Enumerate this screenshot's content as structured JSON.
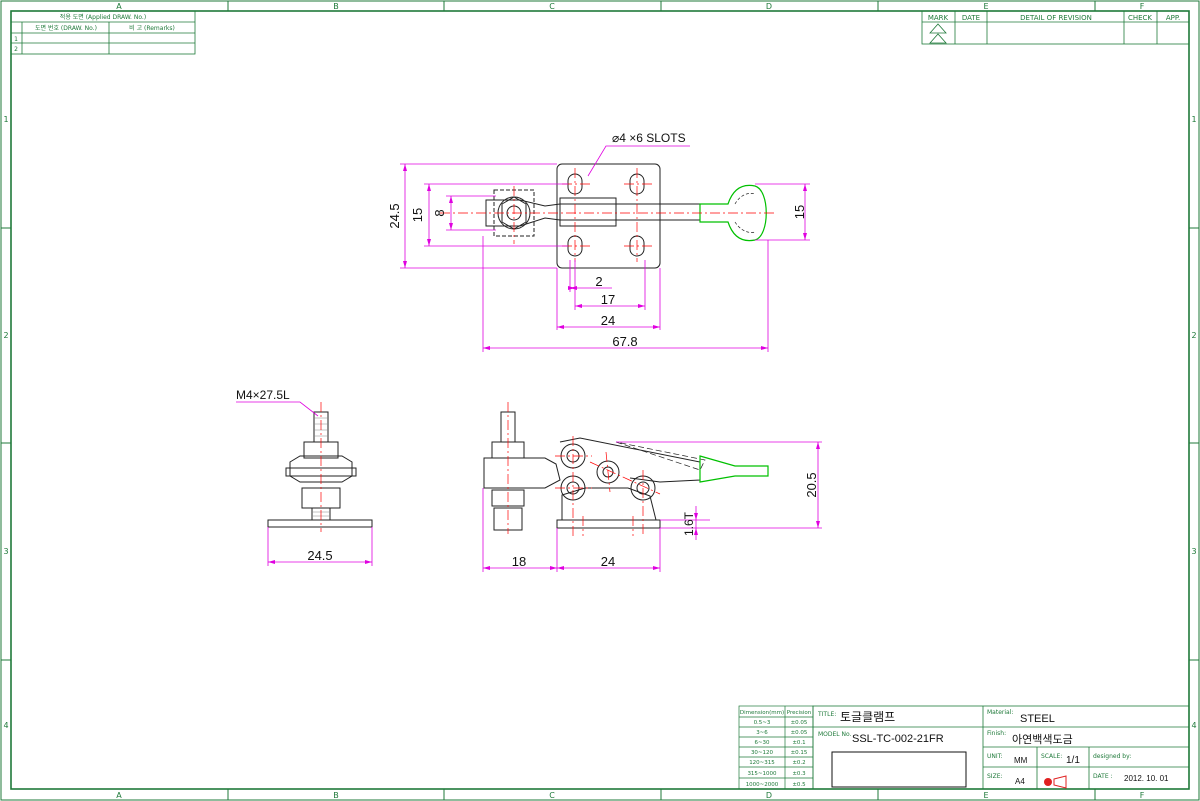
{
  "colors": {
    "border": "#1f7a3a",
    "part": "#222222",
    "dimension": "#e000e0",
    "center": "#ff0000",
    "handle": "#00c000"
  },
  "zones": {
    "columns": [
      "A",
      "B",
      "C",
      "D",
      "E",
      "F"
    ],
    "rows": [
      "1",
      "2",
      "3",
      "4"
    ]
  },
  "applied_table": {
    "title": "적용 도면 (Applied DRAW. No.)",
    "col_draw": "도면 번호 (DRAW. No.)",
    "col_remarks": "비 고 (Remarks)",
    "rows": [
      "1",
      "2"
    ]
  },
  "revision_table": {
    "headers": [
      "MARK",
      "DATE",
      "DETAIL OF REVISION",
      "CHECK",
      "APP."
    ]
  },
  "dimensions": {
    "slots": "⌀4 ×6 SLOTS",
    "v_24_5": "24.5",
    "v_15_left": "15",
    "v_8": "8",
    "v_15_right": "15",
    "h_2": "2",
    "h_17": "17",
    "h_24_top": "24",
    "h_67_8": "67.8",
    "stud": "M4×27.5L",
    "h_24_5": "24.5",
    "h_18": "18",
    "h_24_side": "24",
    "v_20_5": "20.5",
    "thickness": "1.6T"
  },
  "tolerance_table": {
    "header_dim": "Dimension(mm)",
    "header_prec": "Precision",
    "rows": [
      {
        "range": "0.5~3",
        "prec": "±0.05"
      },
      {
        "range": "3~6",
        "prec": "±0.05"
      },
      {
        "range": "6~30",
        "prec": "±0.1"
      },
      {
        "range": "30~120",
        "prec": "±0.15"
      },
      {
        "range": "120~315",
        "prec": "±0.2"
      },
      {
        "range": "315~1000",
        "prec": "±0.3"
      },
      {
        "range": "1000~2000",
        "prec": "±0.5"
      }
    ]
  },
  "title_block": {
    "title_label": "TITLE:",
    "title": "토글클램프",
    "model_label": "MODEL No.",
    "model": "SSL-TC-002-21FR",
    "material_label": "Material:",
    "material": "STEEL",
    "finish_label": "Finish:",
    "finish": "아연백색도금",
    "unit_label": "UNIT:",
    "unit": "MM",
    "scale_label": "SCALE:",
    "scale": "1/1",
    "designed_label": "designed by:",
    "size_label": "SIZE:",
    "size": "A4",
    "date_label": "DATE :",
    "date": "2012. 10. 01"
  }
}
